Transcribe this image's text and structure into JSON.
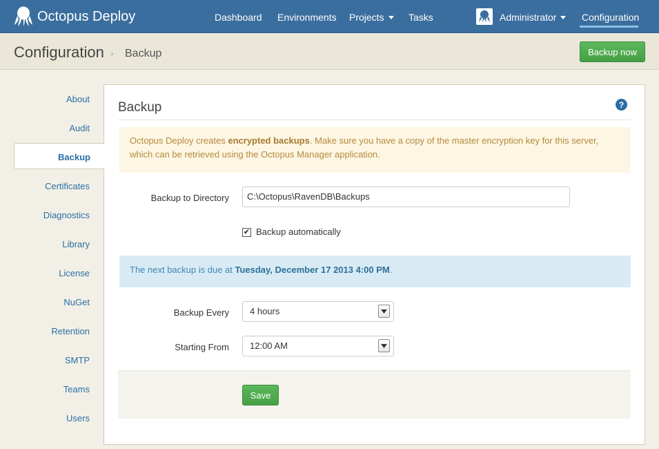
{
  "app": {
    "brand": "Octopus Deploy",
    "accent": "#3a6e9e",
    "icon": "octopus-logo"
  },
  "nav": {
    "dashboard": "Dashboard",
    "environments": "Environments",
    "projects": "Projects",
    "tasks": "Tasks",
    "user": "Administrator",
    "configuration": "Configuration"
  },
  "header": {
    "title": "Configuration",
    "breadcrumb_separator": "›",
    "breadcrumb_current": "Backup",
    "backup_now": "Backup now"
  },
  "sidebar": {
    "items": [
      {
        "label": "About"
      },
      {
        "label": "Audit"
      },
      {
        "label": "Backup",
        "active": true
      },
      {
        "label": "Certificates"
      },
      {
        "label": "Diagnostics"
      },
      {
        "label": "Library"
      },
      {
        "label": "License"
      },
      {
        "label": "NuGet"
      },
      {
        "label": "Retention"
      },
      {
        "label": "SMTP"
      },
      {
        "label": "Teams"
      },
      {
        "label": "Users"
      }
    ]
  },
  "main": {
    "title": "Backup",
    "help_icon": "?",
    "warning": {
      "prefix": "Octopus Deploy creates ",
      "emphasis": "encrypted backups",
      "suffix": ". Make sure you have a copy of the master encryption key for this server, which can be retrieved using the Octopus Manager application."
    },
    "directory": {
      "label": "Backup to Directory",
      "value": "C:\\Octopus\\RavenDB\\Backups"
    },
    "auto_backup": {
      "label": "Backup automatically",
      "checked": true
    },
    "next_backup": {
      "prefix": "The next backup is due at ",
      "emphasis": "Tuesday, December 17 2013 4:00 PM",
      "suffix": "."
    },
    "backup_every": {
      "label": "Backup Every",
      "value": "4 hours"
    },
    "starting_from": {
      "label": "Starting From",
      "value": "12:00 AM"
    },
    "save": "Save"
  }
}
